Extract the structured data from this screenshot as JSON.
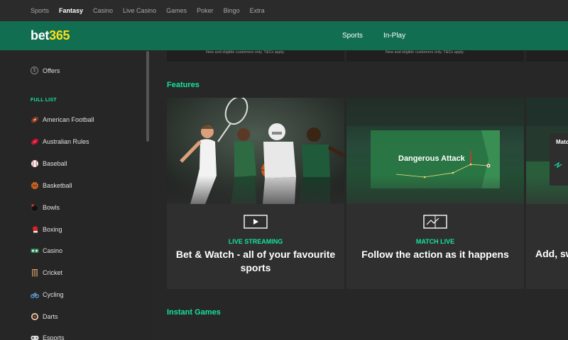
{
  "topnav": {
    "items": [
      "Sports",
      "Fantasy",
      "Casino",
      "Live Casino",
      "Games",
      "Poker",
      "Bingo",
      "Extra"
    ],
    "active": "Fantasy"
  },
  "header": {
    "logo_part1": "bet",
    "logo_part2": "365",
    "nav": [
      "Sports",
      "In-Play"
    ]
  },
  "sidebar": {
    "offers": "Offers",
    "section": "FULL LIST",
    "items": [
      {
        "label": "American Football",
        "icon": "american-football-icon"
      },
      {
        "label": "Australian Rules",
        "icon": "australian-rules-icon"
      },
      {
        "label": "Baseball",
        "icon": "baseball-icon"
      },
      {
        "label": "Basketball",
        "icon": "basketball-icon"
      },
      {
        "label": "Bowls",
        "icon": "bowls-icon"
      },
      {
        "label": "Boxing",
        "icon": "boxing-glove-icon"
      },
      {
        "label": "Casino",
        "icon": "casino-chip-icon"
      },
      {
        "label": "Cricket",
        "icon": "cricket-stumps-icon"
      },
      {
        "label": "Cycling",
        "icon": "bicycle-icon"
      },
      {
        "label": "Darts",
        "icon": "dartboard-icon"
      },
      {
        "label": "Esports",
        "icon": "gamepad-icon"
      }
    ]
  },
  "top_banner_text": "New and eligible customers only. T&Cs apply.",
  "features": {
    "title": "Features",
    "cards": [
      {
        "kicker": "LIVE STREAMING",
        "title": "Bet & Watch - all of your favourite sports",
        "icon": "video-play-icon"
      },
      {
        "kicker": "MATCH LIVE",
        "title": "Follow the action as it happens",
        "icon": "pitch-tracker-icon",
        "overlay": "Dangerous Attack"
      },
      {
        "kicker": "",
        "title": "Add, sw",
        "icon": "",
        "overlay": "Matc"
      }
    ]
  },
  "instant_games": {
    "title": "Instant Games"
  },
  "colors": {
    "accent": "#14e2a0",
    "header": "#126e51",
    "logo_yellow": "#ffdf1b"
  }
}
